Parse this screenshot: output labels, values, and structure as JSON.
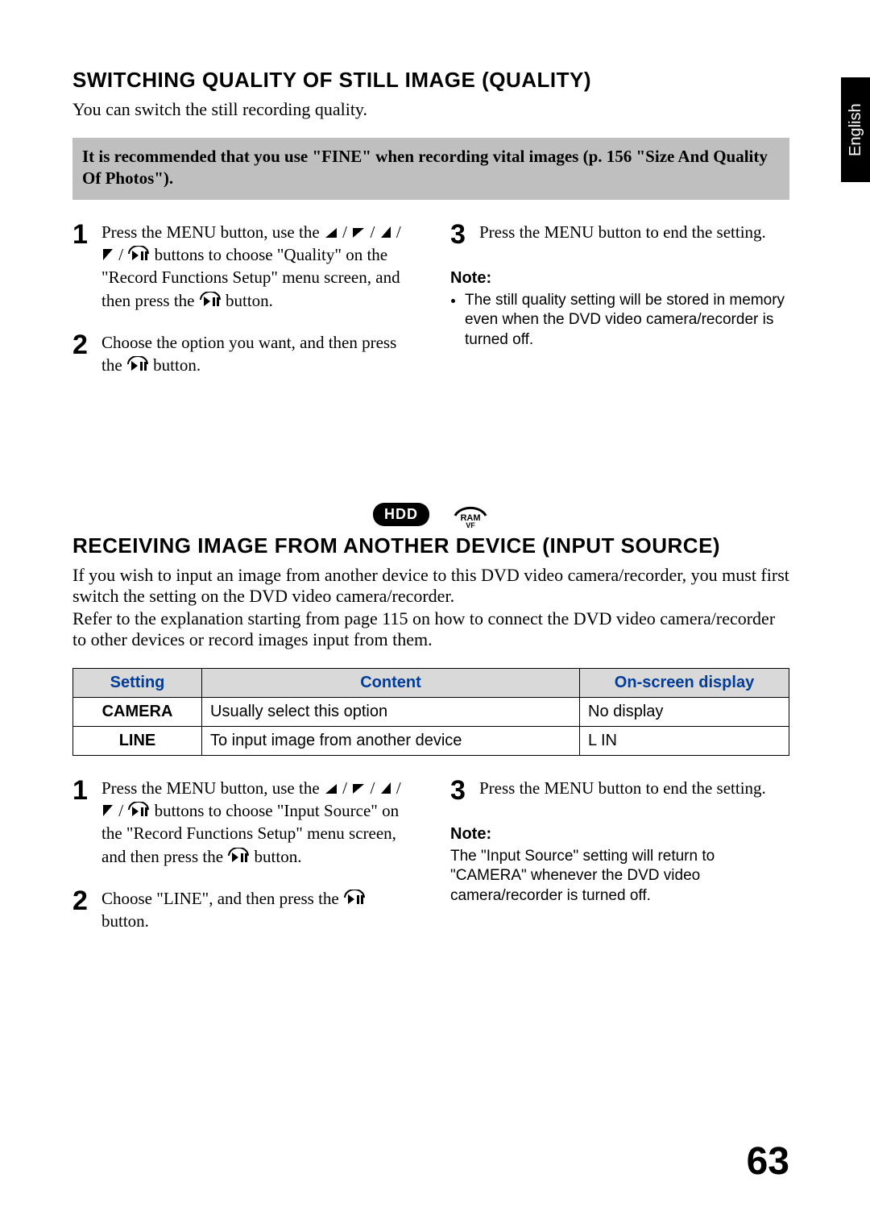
{
  "language_tab": "English",
  "page_number": "63",
  "section1": {
    "heading": "SWITCHING QUALITY OF STILL IMAGE (QUALITY)",
    "lead": "You can switch the still recording quality.",
    "tip": "It is recommended that you use \"FINE\" when recording vital images (p. 156 \"Size And Quality Of Photos\").",
    "steps_left": [
      {
        "num": "1",
        "text_pre": "Press the MENU button, use the ",
        "text_post": " buttons to choose \"Quality\" on the \"Record Functions Setup\" menu screen, and then press the ",
        "text_tail": " button."
      },
      {
        "num": "2",
        "text_pre": "Choose the option you want, and then press the ",
        "text_tail": " button."
      }
    ],
    "steps_right": [
      {
        "num": "3",
        "text_pre": "Press the MENU button to end the setting."
      }
    ],
    "note_heading": "Note:",
    "note_body": "The still quality setting will be stored in memory even when the DVD video camera/recorder is turned off."
  },
  "section2": {
    "badge_hdd": "HDD",
    "badge_ram": "RAM",
    "heading": "RECEIVING IMAGE FROM ANOTHER DEVICE (INPUT SOURCE)",
    "body1": "If you wish to input an image from another device to this DVD video camera/recorder, you must first switch the setting on the DVD video camera/recorder.",
    "body2": "Refer to the explanation starting from page 115 on how to connect the DVD video camera/recorder to other devices or record images input from them.",
    "table": {
      "headers": [
        "Setting",
        "Content",
        "On-screen display"
      ],
      "rows": [
        {
          "setting": "CAMERA",
          "content": "Usually select this option",
          "display": "No display"
        },
        {
          "setting": "LINE",
          "content": "To input image from another device",
          "display": "L IN"
        }
      ]
    },
    "steps_left": [
      {
        "num": "1",
        "text_pre": "Press the MENU button, use the ",
        "text_post": " buttons to choose \"Input Source\" on the \"Record Functions Setup\" menu screen, and then press the ",
        "text_tail": " button."
      },
      {
        "num": "2",
        "text_pre": "Choose \"LINE\", and then press the ",
        "text_tail": " button."
      }
    ],
    "steps_right": [
      {
        "num": "3",
        "text_pre": "Press the MENU button to end the setting."
      }
    ],
    "note_heading": "Note:",
    "note_body": "The \"Input Source\" setting will return to \"CAMERA\" whenever the DVD video camera/recorder is turned off."
  }
}
